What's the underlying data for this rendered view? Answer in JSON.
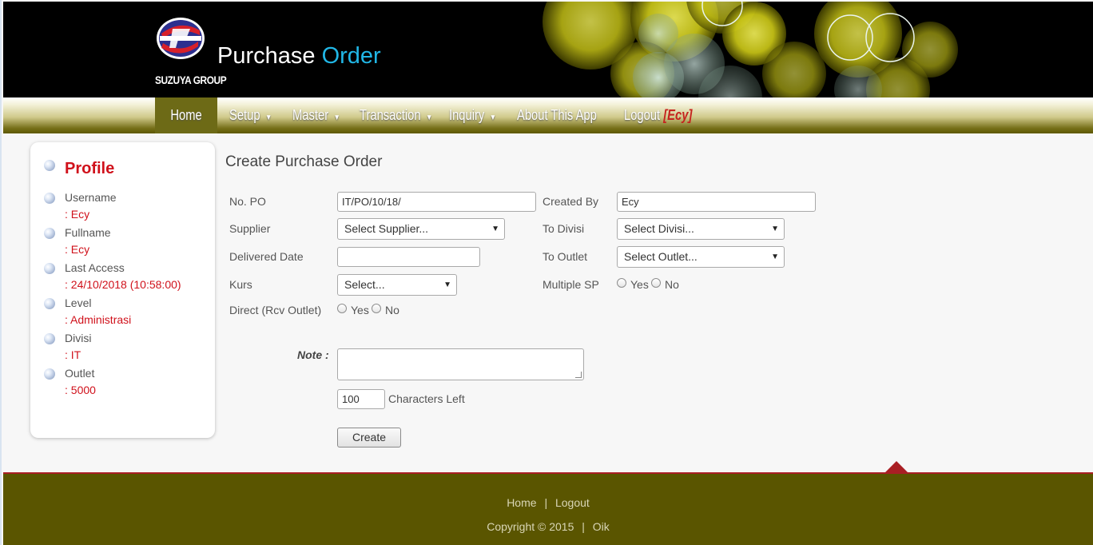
{
  "header": {
    "logo_text": "SUZUYA GROUP",
    "title_part1": "Purchase",
    "title_part2": "Order"
  },
  "nav": {
    "home": "Home",
    "setup": "Setup",
    "master": "Master",
    "transaction": "Transaction",
    "inquiry": "Inquiry",
    "about": "About This App",
    "logout": "Logout",
    "user": "[Ecy]",
    "caret": "▼"
  },
  "profile": {
    "title": "Profile",
    "fields": [
      {
        "label": "Username",
        "value": ": Ecy"
      },
      {
        "label": "Fullname",
        "value": ": Ecy"
      },
      {
        "label": "Last Access",
        "value": ": 24/10/2018 (10:58:00)"
      },
      {
        "label": "Level",
        "value": ": Administrasi"
      },
      {
        "label": "Divisi",
        "value": ": IT"
      },
      {
        "label": "Outlet",
        "value": ": 5000"
      }
    ]
  },
  "form": {
    "heading": "Create Purchase Order",
    "no_po_label": "No. PO",
    "no_po_value": "IT/PO/10/18/",
    "created_by_label": "Created By",
    "created_by_value": "Ecy",
    "supplier_label": "Supplier",
    "supplier_value": "Select Supplier...",
    "to_divisi_label": "To Divisi",
    "to_divisi_value": "Select Divisi...",
    "delivered_date_label": "Delivered Date",
    "delivered_date_value": "",
    "to_outlet_label": "To Outlet",
    "to_outlet_value": "Select Outlet...",
    "kurs_label": "Kurs",
    "kurs_value": "Select...",
    "multiple_sp_label": "Multiple SP",
    "direct_label": "Direct (Rcv Outlet)",
    "yes": "Yes",
    "no": "No",
    "note_label": "Note :",
    "chars_left_value": "100",
    "chars_left_label": "Characters Left",
    "create_button": "Create",
    "select_arrow": "▼"
  },
  "footer": {
    "home": "Home",
    "separator": "|",
    "logout": "Logout",
    "copyright": "Copyright © 2015",
    "author": "Oik"
  },
  "colors": {
    "accent_blue": "#21b7e6",
    "profile_red": "#d0111b",
    "footer_olive": "#5a5500"
  }
}
